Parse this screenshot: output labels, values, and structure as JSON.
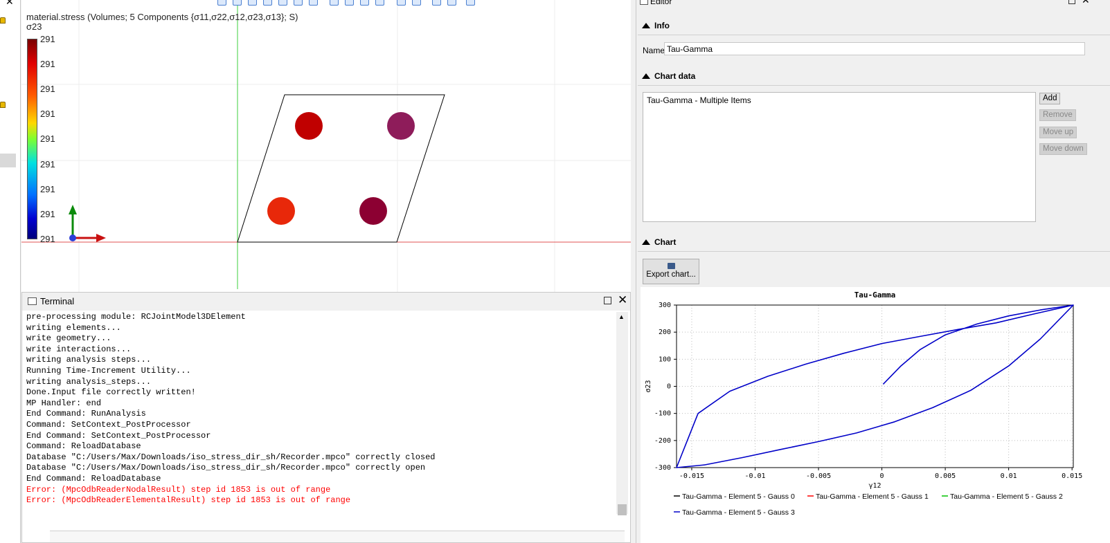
{
  "viewport": {
    "result_title": "material.stress (Volumes; 5 Components {σ11,σ22,σ12,σ23,σ13}; S)",
    "component": "σ23",
    "legend_labels": [
      "291",
      "291",
      "291",
      "291",
      "291",
      "291",
      "291",
      "291",
      "291"
    ],
    "point_colors": [
      "#c00000",
      "#8e1c5a",
      "#e8280a",
      "#8c0032"
    ]
  },
  "terminal": {
    "title": "Terminal",
    "lines": [
      "pre-processing module: RCJointModel3DElement",
      "writing elements...",
      "write geometry...",
      "write interactions...",
      "writing analysis steps...",
      "Running Time-Increment Utility...",
      "writing analysis_steps...",
      "Done.Input file correctly written!",
      "MP Handler: end",
      "End Command: RunAnalysis",
      "Command: SetContext_PostProcessor",
      "End Command: SetContext_PostProcessor",
      "Command: ReloadDatabase",
      "Database \"C:/Users/Max/Downloads/iso_stress_dir_sh/Recorder.mpco\" correctly closed",
      "Database \"C:/Users/Max/Downloads/iso_stress_dir_sh/Recorder.mpco\" correctly open",
      "End Command: ReloadDatabase",
      "Error: (MpcOdbReaderNodalResult) step id 1853 is out of range",
      "Error: (MpcOdbReaderElementalResult) step id 1853 is out of range"
    ],
    "error_color": "#ff0000"
  },
  "editor": {
    "title": "Editor",
    "info_header": "Info",
    "name_label": "Name",
    "name_value": "Tau-Gamma",
    "chart_data_header": "Chart data",
    "list_item": "Tau-Gamma - Multiple Items",
    "buttons": {
      "add": "Add",
      "remove": "Remove",
      "move_up": "Move up",
      "move_down": "Move down",
      "export": "Export chart..."
    },
    "chart_header": "Chart"
  },
  "chart_data": {
    "type": "line",
    "title": "Tau-Gamma",
    "xlabel": "γ12",
    "ylabel": "σ23",
    "xlim": [
      -0.0162,
      0.0151
    ],
    "ylim": [
      -300,
      300
    ],
    "xticks": [
      "-0.015",
      "-0.01",
      "-0.005",
      "0",
      "0.005",
      "0.01",
      "0.015"
    ],
    "xtick_values": [
      -0.015,
      -0.01,
      -0.005,
      0,
      0.005,
      0.01,
      0.015
    ],
    "yticks": [
      "300",
      "200",
      "100",
      "0",
      "-100",
      "-200",
      "-300"
    ],
    "ytick_values": [
      300,
      200,
      100,
      0,
      -100,
      -200,
      -300
    ],
    "grid": true,
    "legend_position": "bottom",
    "series": [
      {
        "name": "Tau-Gamma - Element 5 - Gauss 0",
        "color": "#000000",
        "x": [],
        "y": []
      },
      {
        "name": "Tau-Gamma - Element 5 - Gauss 1",
        "color": "#ff0000",
        "x": [],
        "y": []
      },
      {
        "name": "Tau-Gamma - Element 5 - Gauss 2",
        "color": "#00c000",
        "x": [],
        "y": []
      },
      {
        "name": "Tau-Gamma - Element 5 - Gauss 3",
        "color": "#0000c8",
        "x": [
          0.0001,
          0.0015,
          0.003,
          0.005,
          0.0075,
          0.01,
          0.0125,
          0.0151,
          0.012,
          0.009,
          0.006,
          0.003,
          0,
          -0.003,
          -0.006,
          -0.009,
          -0.012,
          -0.0145,
          -0.0162,
          -0.014,
          -0.011,
          -0.008,
          -0.005,
          -0.002,
          0.001,
          0.004,
          0.007,
          0.01,
          0.0125,
          0.0151
        ],
        "y": [
          8,
          75,
          135,
          190,
          230,
          260,
          282,
          300,
          267,
          234,
          210,
          184,
          158,
          122,
          82,
          37,
          -18,
          -100,
          -300,
          -290,
          -263,
          -233,
          -204,
          -172,
          -131,
          -79,
          -15,
          75,
          175,
          300
        ]
      }
    ]
  }
}
